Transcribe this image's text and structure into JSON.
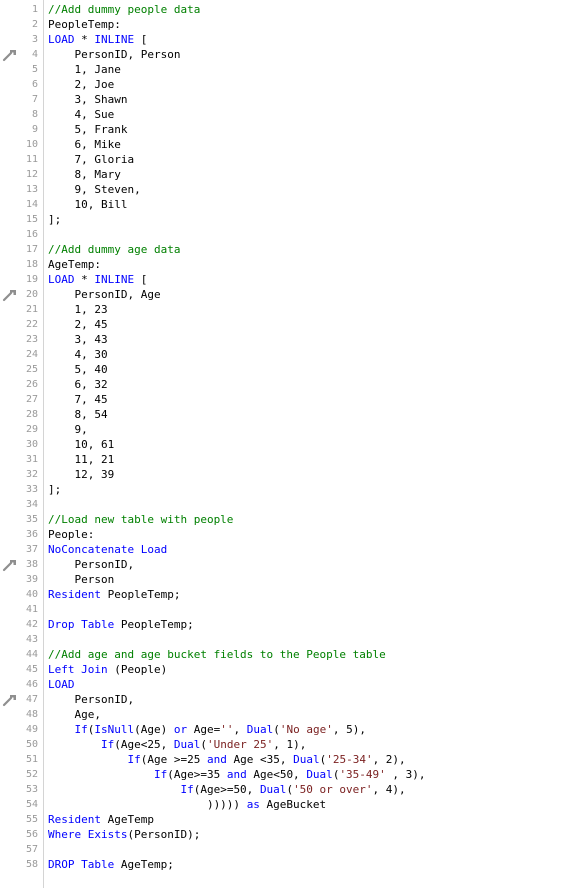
{
  "colors": {
    "comment": "#008000",
    "keyword": "#0000ff",
    "string": "#7a1f1f",
    "text": "#000000",
    "line_number": "#9a9a9a"
  },
  "lines": [
    {
      "num": "1",
      "marker": false,
      "tokens": [
        {
          "t": "//Add dummy people data",
          "c": "comment"
        }
      ]
    },
    {
      "num": "2",
      "marker": true,
      "tokens": [
        {
          "t": "PeopleTemp:",
          "c": "text"
        }
      ]
    },
    {
      "num": "3",
      "marker": false,
      "tokens": [
        {
          "t": "LOAD",
          "c": "keyword"
        },
        {
          "t": " * ",
          "c": "text"
        },
        {
          "t": "INLINE",
          "c": "keyword"
        },
        {
          "t": " [",
          "c": "text"
        }
      ]
    },
    {
      "num": "4",
      "marker": false,
      "tokens": [
        {
          "t": "    PersonID, Person",
          "c": "text"
        }
      ]
    },
    {
      "num": "5",
      "marker": false,
      "tokens": [
        {
          "t": "    1, Jane",
          "c": "text"
        }
      ]
    },
    {
      "num": "6",
      "marker": false,
      "tokens": [
        {
          "t": "    2, Joe",
          "c": "text"
        }
      ]
    },
    {
      "num": "7",
      "marker": false,
      "tokens": [
        {
          "t": "    3, Shawn",
          "c": "text"
        }
      ]
    },
    {
      "num": "8",
      "marker": false,
      "tokens": [
        {
          "t": "    4, Sue",
          "c": "text"
        }
      ]
    },
    {
      "num": "9",
      "marker": false,
      "tokens": [
        {
          "t": "    5, Frank",
          "c": "text"
        }
      ]
    },
    {
      "num": "10",
      "marker": false,
      "tokens": [
        {
          "t": "    6, Mike",
          "c": "text"
        }
      ]
    },
    {
      "num": "11",
      "marker": false,
      "tokens": [
        {
          "t": "    7, Gloria",
          "c": "text"
        }
      ]
    },
    {
      "num": "12",
      "marker": false,
      "tokens": [
        {
          "t": "    8, Mary",
          "c": "text"
        }
      ]
    },
    {
      "num": "13",
      "marker": false,
      "tokens": [
        {
          "t": "    9, Steven,",
          "c": "text"
        }
      ]
    },
    {
      "num": "14",
      "marker": false,
      "tokens": [
        {
          "t": "    10, Bill",
          "c": "text"
        }
      ]
    },
    {
      "num": "15",
      "marker": false,
      "tokens": [
        {
          "t": "];",
          "c": "text"
        }
      ]
    },
    {
      "num": "16",
      "marker": false,
      "tokens": []
    },
    {
      "num": "17",
      "marker": false,
      "tokens": [
        {
          "t": "//Add dummy age data",
          "c": "comment"
        }
      ]
    },
    {
      "num": "18",
      "marker": true,
      "tokens": [
        {
          "t": "AgeTemp:",
          "c": "text"
        }
      ]
    },
    {
      "num": "19",
      "marker": false,
      "tokens": [
        {
          "t": "LOAD",
          "c": "keyword"
        },
        {
          "t": " * ",
          "c": "text"
        },
        {
          "t": "INLINE",
          "c": "keyword"
        },
        {
          "t": " [",
          "c": "text"
        }
      ]
    },
    {
      "num": "20",
      "marker": false,
      "tokens": [
        {
          "t": "    PersonID, Age",
          "c": "text"
        }
      ]
    },
    {
      "num": "21",
      "marker": false,
      "tokens": [
        {
          "t": "    1, 23",
          "c": "text"
        }
      ]
    },
    {
      "num": "22",
      "marker": false,
      "tokens": [
        {
          "t": "    2, 45",
          "c": "text"
        }
      ]
    },
    {
      "num": "23",
      "marker": false,
      "tokens": [
        {
          "t": "    3, 43",
          "c": "text"
        }
      ]
    },
    {
      "num": "24",
      "marker": false,
      "tokens": [
        {
          "t": "    4, 30",
          "c": "text"
        }
      ]
    },
    {
      "num": "25",
      "marker": false,
      "tokens": [
        {
          "t": "    5, 40",
          "c": "text"
        }
      ]
    },
    {
      "num": "26",
      "marker": false,
      "tokens": [
        {
          "t": "    6, 32",
          "c": "text"
        }
      ]
    },
    {
      "num": "27",
      "marker": false,
      "tokens": [
        {
          "t": "    7, 45",
          "c": "text"
        }
      ]
    },
    {
      "num": "28",
      "marker": false,
      "tokens": [
        {
          "t": "    8, 54",
          "c": "text"
        }
      ]
    },
    {
      "num": "29",
      "marker": false,
      "tokens": [
        {
          "t": "    9,",
          "c": "text"
        }
      ]
    },
    {
      "num": "30",
      "marker": false,
      "tokens": [
        {
          "t": "    10, 61",
          "c": "text"
        }
      ]
    },
    {
      "num": "31",
      "marker": false,
      "tokens": [
        {
          "t": "    11, 21",
          "c": "text"
        }
      ]
    },
    {
      "num": "32",
      "marker": false,
      "tokens": [
        {
          "t": "    12, 39",
          "c": "text"
        }
      ]
    },
    {
      "num": "33",
      "marker": false,
      "tokens": [
        {
          "t": "];",
          "c": "text"
        }
      ]
    },
    {
      "num": "34",
      "marker": false,
      "tokens": []
    },
    {
      "num": "35",
      "marker": false,
      "tokens": [
        {
          "t": "//Load new table with people",
          "c": "comment"
        }
      ]
    },
    {
      "num": "36",
      "marker": true,
      "tokens": [
        {
          "t": "People:",
          "c": "text"
        }
      ]
    },
    {
      "num": "37",
      "marker": false,
      "tokens": [
        {
          "t": "NoConcatenate Load",
          "c": "keyword"
        }
      ]
    },
    {
      "num": "38",
      "marker": false,
      "tokens": [
        {
          "t": "    PersonID,",
          "c": "text"
        }
      ]
    },
    {
      "num": "39",
      "marker": false,
      "tokens": [
        {
          "t": "    Person",
          "c": "text"
        }
      ]
    },
    {
      "num": "40",
      "marker": false,
      "tokens": [
        {
          "t": "Resident",
          "c": "keyword"
        },
        {
          "t": " PeopleTemp;",
          "c": "text"
        }
      ]
    },
    {
      "num": "41",
      "marker": false,
      "tokens": []
    },
    {
      "num": "42",
      "marker": false,
      "tokens": [
        {
          "t": "Drop Table",
          "c": "keyword"
        },
        {
          "t": " PeopleTemp;",
          "c": "text"
        }
      ]
    },
    {
      "num": "43",
      "marker": false,
      "tokens": []
    },
    {
      "num": "44",
      "marker": false,
      "tokens": [
        {
          "t": "//Add age and age bucket fields to the People table",
          "c": "comment"
        }
      ]
    },
    {
      "num": "45",
      "marker": true,
      "tokens": [
        {
          "t": "Left Join",
          "c": "keyword"
        },
        {
          "t": " (People)",
          "c": "text"
        }
      ]
    },
    {
      "num": "46",
      "marker": false,
      "tokens": [
        {
          "t": "LOAD",
          "c": "keyword"
        }
      ]
    },
    {
      "num": "47",
      "marker": false,
      "tokens": [
        {
          "t": "    PersonID,",
          "c": "text"
        }
      ]
    },
    {
      "num": "48",
      "marker": false,
      "tokens": [
        {
          "t": "    Age,",
          "c": "text"
        }
      ]
    },
    {
      "num": "49",
      "marker": false,
      "tokens": [
        {
          "t": "    ",
          "c": "text"
        },
        {
          "t": "If",
          "c": "keyword"
        },
        {
          "t": "(",
          "c": "text"
        },
        {
          "t": "IsNull",
          "c": "keyword"
        },
        {
          "t": "(Age) ",
          "c": "text"
        },
        {
          "t": "or",
          "c": "keyword"
        },
        {
          "t": " Age=",
          "c": "text"
        },
        {
          "t": "''",
          "c": "string"
        },
        {
          "t": ", ",
          "c": "text"
        },
        {
          "t": "Dual",
          "c": "keyword"
        },
        {
          "t": "(",
          "c": "text"
        },
        {
          "t": "'No age'",
          "c": "string"
        },
        {
          "t": ", 5),",
          "c": "text"
        }
      ]
    },
    {
      "num": "50",
      "marker": false,
      "tokens": [
        {
          "t": "        ",
          "c": "text"
        },
        {
          "t": "If",
          "c": "keyword"
        },
        {
          "t": "(Age<25, ",
          "c": "text"
        },
        {
          "t": "Dual",
          "c": "keyword"
        },
        {
          "t": "(",
          "c": "text"
        },
        {
          "t": "'Under 25'",
          "c": "string"
        },
        {
          "t": ", 1),",
          "c": "text"
        }
      ]
    },
    {
      "num": "51",
      "marker": false,
      "tokens": [
        {
          "t": "            ",
          "c": "text"
        },
        {
          "t": "If",
          "c": "keyword"
        },
        {
          "t": "(Age >=25 ",
          "c": "text"
        },
        {
          "t": "and",
          "c": "keyword"
        },
        {
          "t": " Age <35, ",
          "c": "text"
        },
        {
          "t": "Dual",
          "c": "keyword"
        },
        {
          "t": "(",
          "c": "text"
        },
        {
          "t": "'25-34'",
          "c": "string"
        },
        {
          "t": ", 2),",
          "c": "text"
        }
      ]
    },
    {
      "num": "52",
      "marker": false,
      "tokens": [
        {
          "t": "                ",
          "c": "text"
        },
        {
          "t": "If",
          "c": "keyword"
        },
        {
          "t": "(Age>=35 ",
          "c": "text"
        },
        {
          "t": "and",
          "c": "keyword"
        },
        {
          "t": " Age<50, ",
          "c": "text"
        },
        {
          "t": "Dual",
          "c": "keyword"
        },
        {
          "t": "(",
          "c": "text"
        },
        {
          "t": "'35-49'",
          "c": "string"
        },
        {
          "t": " , 3),",
          "c": "text"
        }
      ]
    },
    {
      "num": "53",
      "marker": false,
      "tokens": [
        {
          "t": "                    ",
          "c": "text"
        },
        {
          "t": "If",
          "c": "keyword"
        },
        {
          "t": "(Age>=50, ",
          "c": "text"
        },
        {
          "t": "Dual",
          "c": "keyword"
        },
        {
          "t": "(",
          "c": "text"
        },
        {
          "t": "'50 or over'",
          "c": "string"
        },
        {
          "t": ", 4),",
          "c": "text"
        }
      ]
    },
    {
      "num": "54",
      "marker": false,
      "tokens": [
        {
          "t": "                        ))))) ",
          "c": "text"
        },
        {
          "t": "as",
          "c": "keyword"
        },
        {
          "t": " AgeBucket",
          "c": "text"
        }
      ]
    },
    {
      "num": "55",
      "marker": false,
      "tokens": [
        {
          "t": "Resident",
          "c": "keyword"
        },
        {
          "t": " AgeTemp",
          "c": "text"
        }
      ]
    },
    {
      "num": "56",
      "marker": false,
      "tokens": [
        {
          "t": "Where Exists",
          "c": "keyword"
        },
        {
          "t": "(PersonID);",
          "c": "text"
        }
      ]
    },
    {
      "num": "57",
      "marker": false,
      "tokens": []
    },
    {
      "num": "58",
      "marker": false,
      "tokens": [
        {
          "t": "DROP Table",
          "c": "keyword"
        },
        {
          "t": " AgeTemp;",
          "c": "text"
        }
      ]
    }
  ]
}
